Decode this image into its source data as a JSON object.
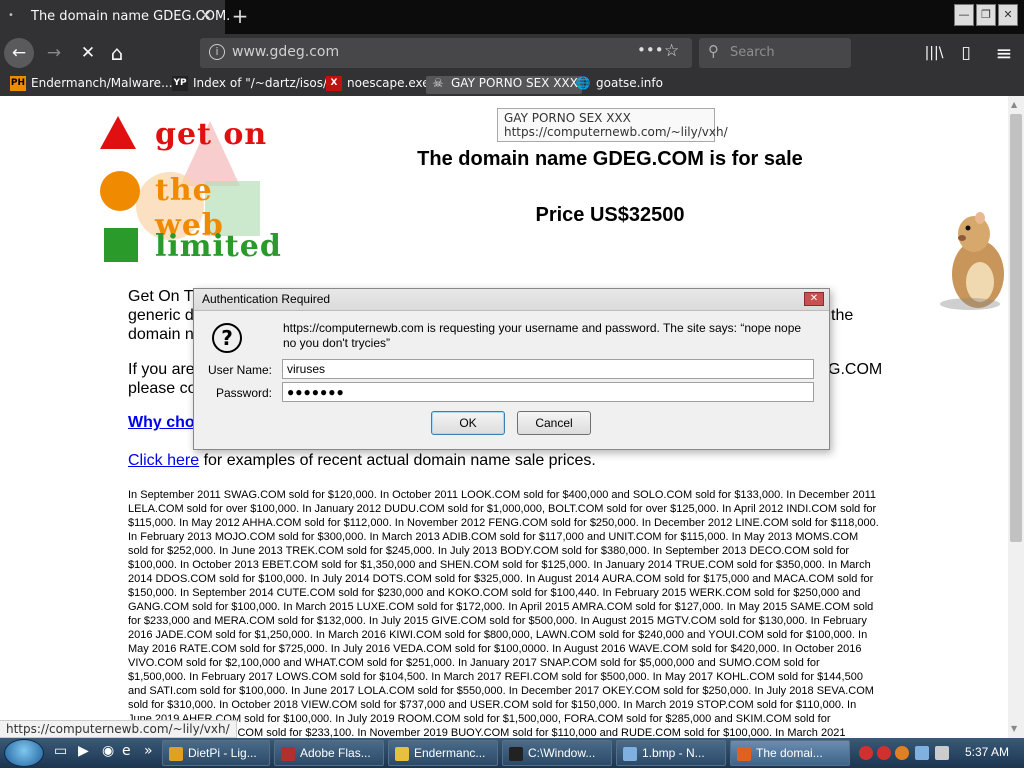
{
  "tab": {
    "title": "The domain name GDEG.COM.",
    "close": "✕",
    "new_tab": "+"
  },
  "window": {
    "min": "—",
    "max": "❐",
    "close": "✕"
  },
  "nav": {
    "back": "←",
    "forward": "→",
    "stop": "✕",
    "home": "⌂",
    "info": "i",
    "url": "www.gdeg.com",
    "page_actions": "•••",
    "bookmark_star": "☆",
    "search_placeholder": "Search",
    "library": "|||\\",
    "sidebar": "▯",
    "menu": "≡"
  },
  "bookmarks": [
    {
      "icon": "PH",
      "label": "Endermanch/Malware..."
    },
    {
      "icon": "YP",
      "label": "Index of \"/~dartz/isos/\""
    },
    {
      "icon": "X",
      "label": "noescape.exe"
    },
    {
      "icon": "☠",
      "label": "GAY PORNO SEX XXX"
    },
    {
      "icon": "🌐",
      "label": "goatse.info"
    }
  ],
  "logo": {
    "line1": "get on",
    "line2": "the web",
    "line3": "limited"
  },
  "page": {
    "heading": "The domain name GDEG.COM is for sale",
    "price": "Price US$32500",
    "p1_start": "Get On Th",
    "p1_line2": "generic d",
    "p1_line3": "domain na",
    "p1_right": "the",
    "p2_start": "If you are",
    "p2_line2": "please co",
    "p2_right": "G.COM",
    "why_link": "Why cho",
    "click_here": "Click here",
    "click_rest": " for examples of recent actual domain name sale prices.",
    "sales_text": "In September 2011 SWAG.COM sold for $120,000.    In October 2011 LOOK.COM sold for $400,000 and SOLO.COM sold for $133,000.    In December 2011 LELA.COM sold for over $100,000.    In January 2012 DUDU.COM sold for $1,000,000, BOLT.COM sold for over $125,000.    In April 2012 INDI.COM sold for $115,000.    In May 2012 AHHA.COM sold for $112,000.    In November 2012 FENG.COM sold for $250,000.    In December 2012 LINE.COM sold for $118,000.    In February 2013 MOJO.COM sold for $300,000.    In March 2013 ADIB.COM sold for $117,000 and UNIT.COM for $115,000.    In May 2013 MOMS.COM sold for $252,000.    In June 2013 TREK.COM sold for $245,000.    In July 2013 BODY.COM sold for $380,000.    In September 2013 DECO.COM sold for $100,000.    In October 2013 EBET.COM sold for $1,350,000 and SHEN.COM sold for $125,000.    In January 2014 TRUE.COM sold for $350,000.    In March 2014 DDOS.COM sold for $100,000.    In July 2014 DOTS.COM sold for $325,000.    In August 2014 AURA.COM sold for $175,000 and MACA.COM sold for $150,000.    In September 2014 CUTE.COM sold for $230,000 and KOKO.COM sold for $100,440.    In February 2015 WERK.COM sold for $250,000 and GANG.COM sold for $100,000.    In March 2015 LUXE.COM sold for $172,000.    In April 2015 AMRA.COM sold for $127,000.    In May 2015 SAME.COM sold for $233,000 and MERA.COM sold for $132,000.    In July 2015 GIVE.COM sold for $500,000.    In August 2015 MGTV.COM sold for $130,000.    In February 2016 JADE.COM sold for $1,250,000.    In March 2016 KIWI.COM sold for $800,000, LAWN.COM sold for $240,000 and YOUI.COM sold for $100,000.    In May 2016 RATE.COM sold for $725,000.    In July 2016 VEDA.COM sold for $100,0000.    In August 2016 WAVE.COM sold for $420,000.    In October 2016 VIVO.COM sold for $2,100,000 and WHAT.COM sold for $251,000.    In January 2017 SNAP.COM sold for $5,000,000 and SUMO.COM sold for $1,500,000.    In February 2017 LOWS.COM sold for $104,500.    In March 2017 REFI.COM sold for $500,000.    In May 2017 KOHL.COM sold for $144,500 and SATI.com sold for $100,000.    In June 2017 LOLA.COM sold for $550,000.    In December 2017 OKEY.COM sold for $250,000.    In July 2018 SEVA.COM sold for $310,000.    In October 2018 VIEW.COM sold for $737,000 and USER.COM sold for $150,000.    In March 2019 STOP.COM sold for $110,000.    In June 2019 AHER.COM sold for $100,000.    In July 2019 ROOM.COM sold for $1,500,000, FORA.COM sold for $285,000 and SKIM.COM sold for $105,000.    In 2019 KE.COM sold for $233,100.    In November 2019 BUOY.COM sold for $110,000 and RUDE.COM sold for $100,000.    In March 2021"
  },
  "tooltip": {
    "title": "GAY PORNO SEX XXX",
    "url": "https://computernewb.com/~lily/vxh/"
  },
  "status_url": "https://computernewb.com/~lily/vxh/",
  "dialog": {
    "title": "Authentication Required",
    "close": "✕",
    "icon": "?",
    "message": "https://computernewb.com is requesting your username and password. The site says: “nope nope no you don't trycies”",
    "username_label": "User Name:",
    "username_value": "viruses",
    "password_label": "Password:",
    "password_value": "●●●●●●●",
    "ok": "OK",
    "cancel": "Cancel"
  },
  "taskbar": {
    "quicklaunch_arrow": "»",
    "tasks": [
      {
        "label": "DietPi - Lig...",
        "color": "#e0a020"
      },
      {
        "label": "Adobe Flas...",
        "color": "#b03030"
      },
      {
        "label": "Endermanc...",
        "color": "#e8c040"
      },
      {
        "label": "C:\\Window...",
        "color": "#222222"
      },
      {
        "label": "1.bmp - N...",
        "color": "#7fb0e0"
      },
      {
        "label": "The domai...",
        "color": "#e06020"
      }
    ],
    "clock": "5:37 AM"
  },
  "colors": {
    "browser_dark": "#323234",
    "link": "#0000ee",
    "logo_red": "#e01010",
    "logo_green": "#2a9a2a",
    "logo_orange": "#f08a00"
  }
}
